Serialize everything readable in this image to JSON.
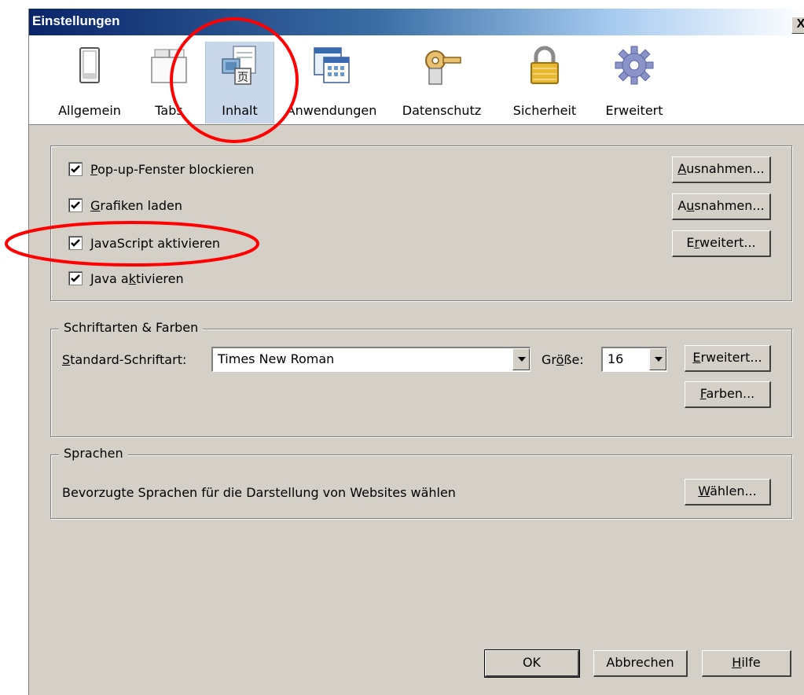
{
  "window": {
    "title": "Einstellungen",
    "close_label": "X"
  },
  "panes": [
    {
      "label": "Allgemein",
      "icon": "switch-icon"
    },
    {
      "label": "Tabs",
      "icon": "tabs-icon"
    },
    {
      "label": "Inhalt",
      "icon": "content-icon",
      "selected": true
    },
    {
      "label": "Anwendungen",
      "icon": "applications-icon"
    },
    {
      "label": "Datenschutz",
      "icon": "key-icon"
    },
    {
      "label": "Sicherheit",
      "icon": "lock-icon"
    },
    {
      "label": "Erweitert",
      "icon": "gear-icon"
    }
  ],
  "content": {
    "options": [
      {
        "label_pre": "",
        "accel": "P",
        "label_post": "op-up-Fenster blockieren",
        "checked": true
      },
      {
        "label_pre": "",
        "accel": "G",
        "label_post": "rafiken laden",
        "checked": true
      },
      {
        "label_pre": "",
        "accel": "J",
        "label_post": "avaScript aktivieren",
        "checked": true
      },
      {
        "label_pre": "Java a",
        "accel": "k",
        "label_post": "tivieren",
        "checked": true
      }
    ],
    "buttons": [
      {
        "pre": "",
        "accel": "A",
        "post": "usnahmen..."
      },
      {
        "pre": "A",
        "accel": "u",
        "post": "snahmen..."
      },
      {
        "pre": "E",
        "accel": "r",
        "post": "weitert..."
      }
    ]
  },
  "fonts": {
    "caption": "Schriftarten & Farben",
    "default_font_label_pre": "",
    "default_font_label_accel": "S",
    "default_font_label_post": "tandard-Schriftart:",
    "default_font_value": "Times New Roman",
    "size_label_pre": "Gr",
    "size_label_accel": "ö",
    "size_label_post": "ße:",
    "size_value": "16",
    "advanced_pre": "",
    "advanced_accel": "E",
    "advanced_post": "rweitert...",
    "colors_pre": "",
    "colors_accel": "F",
    "colors_post": "arben..."
  },
  "languages": {
    "caption": "Sprachen",
    "description": "Bevorzugte Sprachen für die Darstellung von Websites wählen",
    "choose_pre": "",
    "choose_accel": "W",
    "choose_post": "ählen..."
  },
  "footer": {
    "ok": "OK",
    "cancel": "Abbrechen",
    "help_pre": "",
    "help_accel": "H",
    "help_post": "ilfe"
  },
  "colors": {
    "annotation": "#ff0000",
    "selected_pane": "#c8d7ea",
    "dialog_bg": "#d4d0c8",
    "title_start": "#0a246a"
  }
}
